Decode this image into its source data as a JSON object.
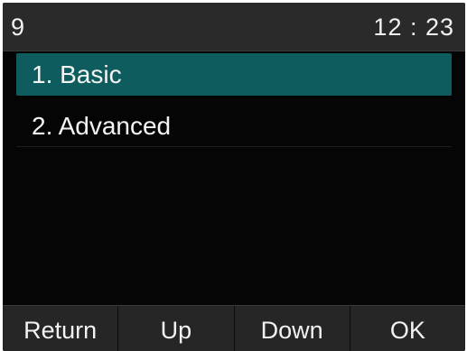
{
  "status_bar": {
    "account": "9",
    "time": "12 : 23"
  },
  "menu": {
    "items": [
      {
        "label": "1.  Basic",
        "selected": true
      },
      {
        "label": "2.  Advanced",
        "selected": false
      }
    ]
  },
  "softkeys": {
    "labels": [
      "Return",
      "Up",
      "Down",
      "OK"
    ]
  },
  "colors": {
    "screen_background": "#050505",
    "bar_background": "#262626",
    "selection_highlight": "#0e5c5e",
    "text": "#f2f2f2"
  }
}
